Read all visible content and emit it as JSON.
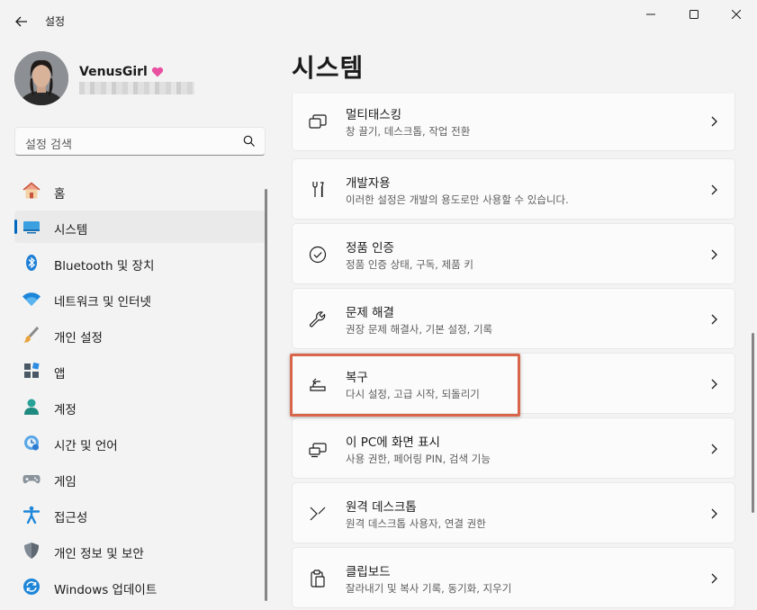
{
  "window": {
    "title": "설정"
  },
  "profile": {
    "name": "VenusGirl",
    "badge_icon": "heart-icon",
    "badge_color": "#e94fa0"
  },
  "search": {
    "placeholder": "설정 검색"
  },
  "sidebar": {
    "items": [
      {
        "label": "홈",
        "icon": "home-icon",
        "active": false
      },
      {
        "label": "시스템",
        "icon": "system-icon",
        "active": true
      },
      {
        "label": "Bluetooth 및 장치",
        "icon": "bluetooth-icon",
        "active": false
      },
      {
        "label": "네트워크 및 인터넷",
        "icon": "wifi-icon",
        "active": false
      },
      {
        "label": "개인 설정",
        "icon": "brush-icon",
        "active": false
      },
      {
        "label": "앱",
        "icon": "apps-icon",
        "active": false
      },
      {
        "label": "계정",
        "icon": "account-icon",
        "active": false
      },
      {
        "label": "시간 및 언어",
        "icon": "time-language-icon",
        "active": false
      },
      {
        "label": "게임",
        "icon": "gamepad-icon",
        "active": false
      },
      {
        "label": "접근성",
        "icon": "accessibility-icon",
        "active": false
      },
      {
        "label": "개인 정보 및 보안",
        "icon": "shield-icon",
        "active": false
      },
      {
        "label": "Windows 업데이트",
        "icon": "update-icon",
        "active": false
      }
    ]
  },
  "main": {
    "title": "시스템",
    "cards": [
      {
        "title": "멀티태스킹",
        "subtitle": "창 끌기, 데스크톱, 작업 전환",
        "icon": "multitasking-icon"
      },
      {
        "title": "개발자용",
        "subtitle": "이러한 설정은 개발의 용도로만 사용할 수 있습니다.",
        "icon": "developer-tools-icon"
      },
      {
        "title": "정품 인증",
        "subtitle": "정품 인증 상태, 구독, 제품 키",
        "icon": "activation-check-icon"
      },
      {
        "title": "문제 해결",
        "subtitle": "권장 문제 해결사, 기본 설정, 기록",
        "icon": "wrench-icon"
      },
      {
        "title": "복구",
        "subtitle": "다시 설정, 고급 시작, 되돌리기",
        "icon": "recovery-icon",
        "highlighted": true
      },
      {
        "title": "이 PC에 화면 표시",
        "subtitle": "사용 권한, 페어링 PIN, 검색 기능",
        "icon": "project-screen-icon"
      },
      {
        "title": "원격 데스크톱",
        "subtitle": "원격 데스크톱 사용자, 연결 권한",
        "icon": "remote-desktop-icon"
      },
      {
        "title": "클립보드",
        "subtitle": "잘라내기 및 복사 기록, 동기화, 지우기",
        "icon": "clipboard-icon"
      }
    ]
  },
  "colors": {
    "accent": "#0067c0",
    "highlight_border": "#d9654a",
    "background": "#f3f3f3",
    "card": "#fbfbfb"
  }
}
